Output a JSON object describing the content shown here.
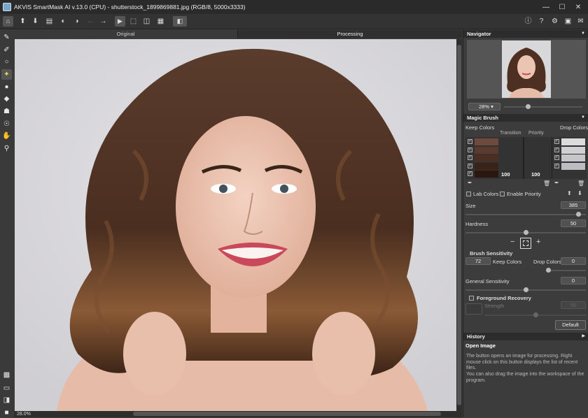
{
  "window": {
    "title": "AKVIS SmartMask AI v.13.0 (CPU) - shutterstock_1899869881.jpg (RGB/8, 5000x3333)",
    "minimize": "—",
    "maximize": "☐",
    "close": "✕"
  },
  "tabs": {
    "original": "Original",
    "processing": "Processing"
  },
  "status": {
    "zoom": "28.0%"
  },
  "navigator": {
    "title": "Navigator",
    "zoom": "28%"
  },
  "magic_brush": {
    "title": "Magic Brush",
    "keep_colors": "Keep Colors",
    "drop_colors": "Drop Colors",
    "transition": "Transition",
    "priority": "Priority",
    "transition_value": "100",
    "priority_value": "100",
    "keep_swatches": [
      "#6e4a3c",
      "#5a3a2c",
      "#4a2e22",
      "#3a2218",
      "#2a1810"
    ],
    "drop_swatches": [
      "#dcdcde",
      "#d0d0d3",
      "#c6c6ca",
      "#bdbdc1"
    ],
    "lab_colors": "Lab Colors",
    "enable_priority": "Enable Priority",
    "size_label": "Size",
    "size_value": "385",
    "size_level": 0.96,
    "hardness_label": "Hardness",
    "hardness_value": "50",
    "hardness_level": 0.5,
    "brush_sensitivity": "Brush Sensitivity",
    "brush_keep_value": "72",
    "brush_keep_label": "Keep Colors",
    "brush_drop_label": "Drop Colors",
    "brush_drop_value": "0",
    "brush_drop_level": 0.0,
    "general_sensitivity": "General Sensitivity",
    "general_value": "0",
    "general_level": 0.5,
    "foreground_recovery": "Foreground Recovery",
    "strength_label": "Strength",
    "strength_value": "50",
    "default_button": "Default"
  },
  "history": {
    "title": "History",
    "open_image_title": "Open Image",
    "text1": "The button opens an image for processing. Right mouse click on this button displays the list of recent files.",
    "text2": "You can also drag the image into the workspace of the program."
  }
}
